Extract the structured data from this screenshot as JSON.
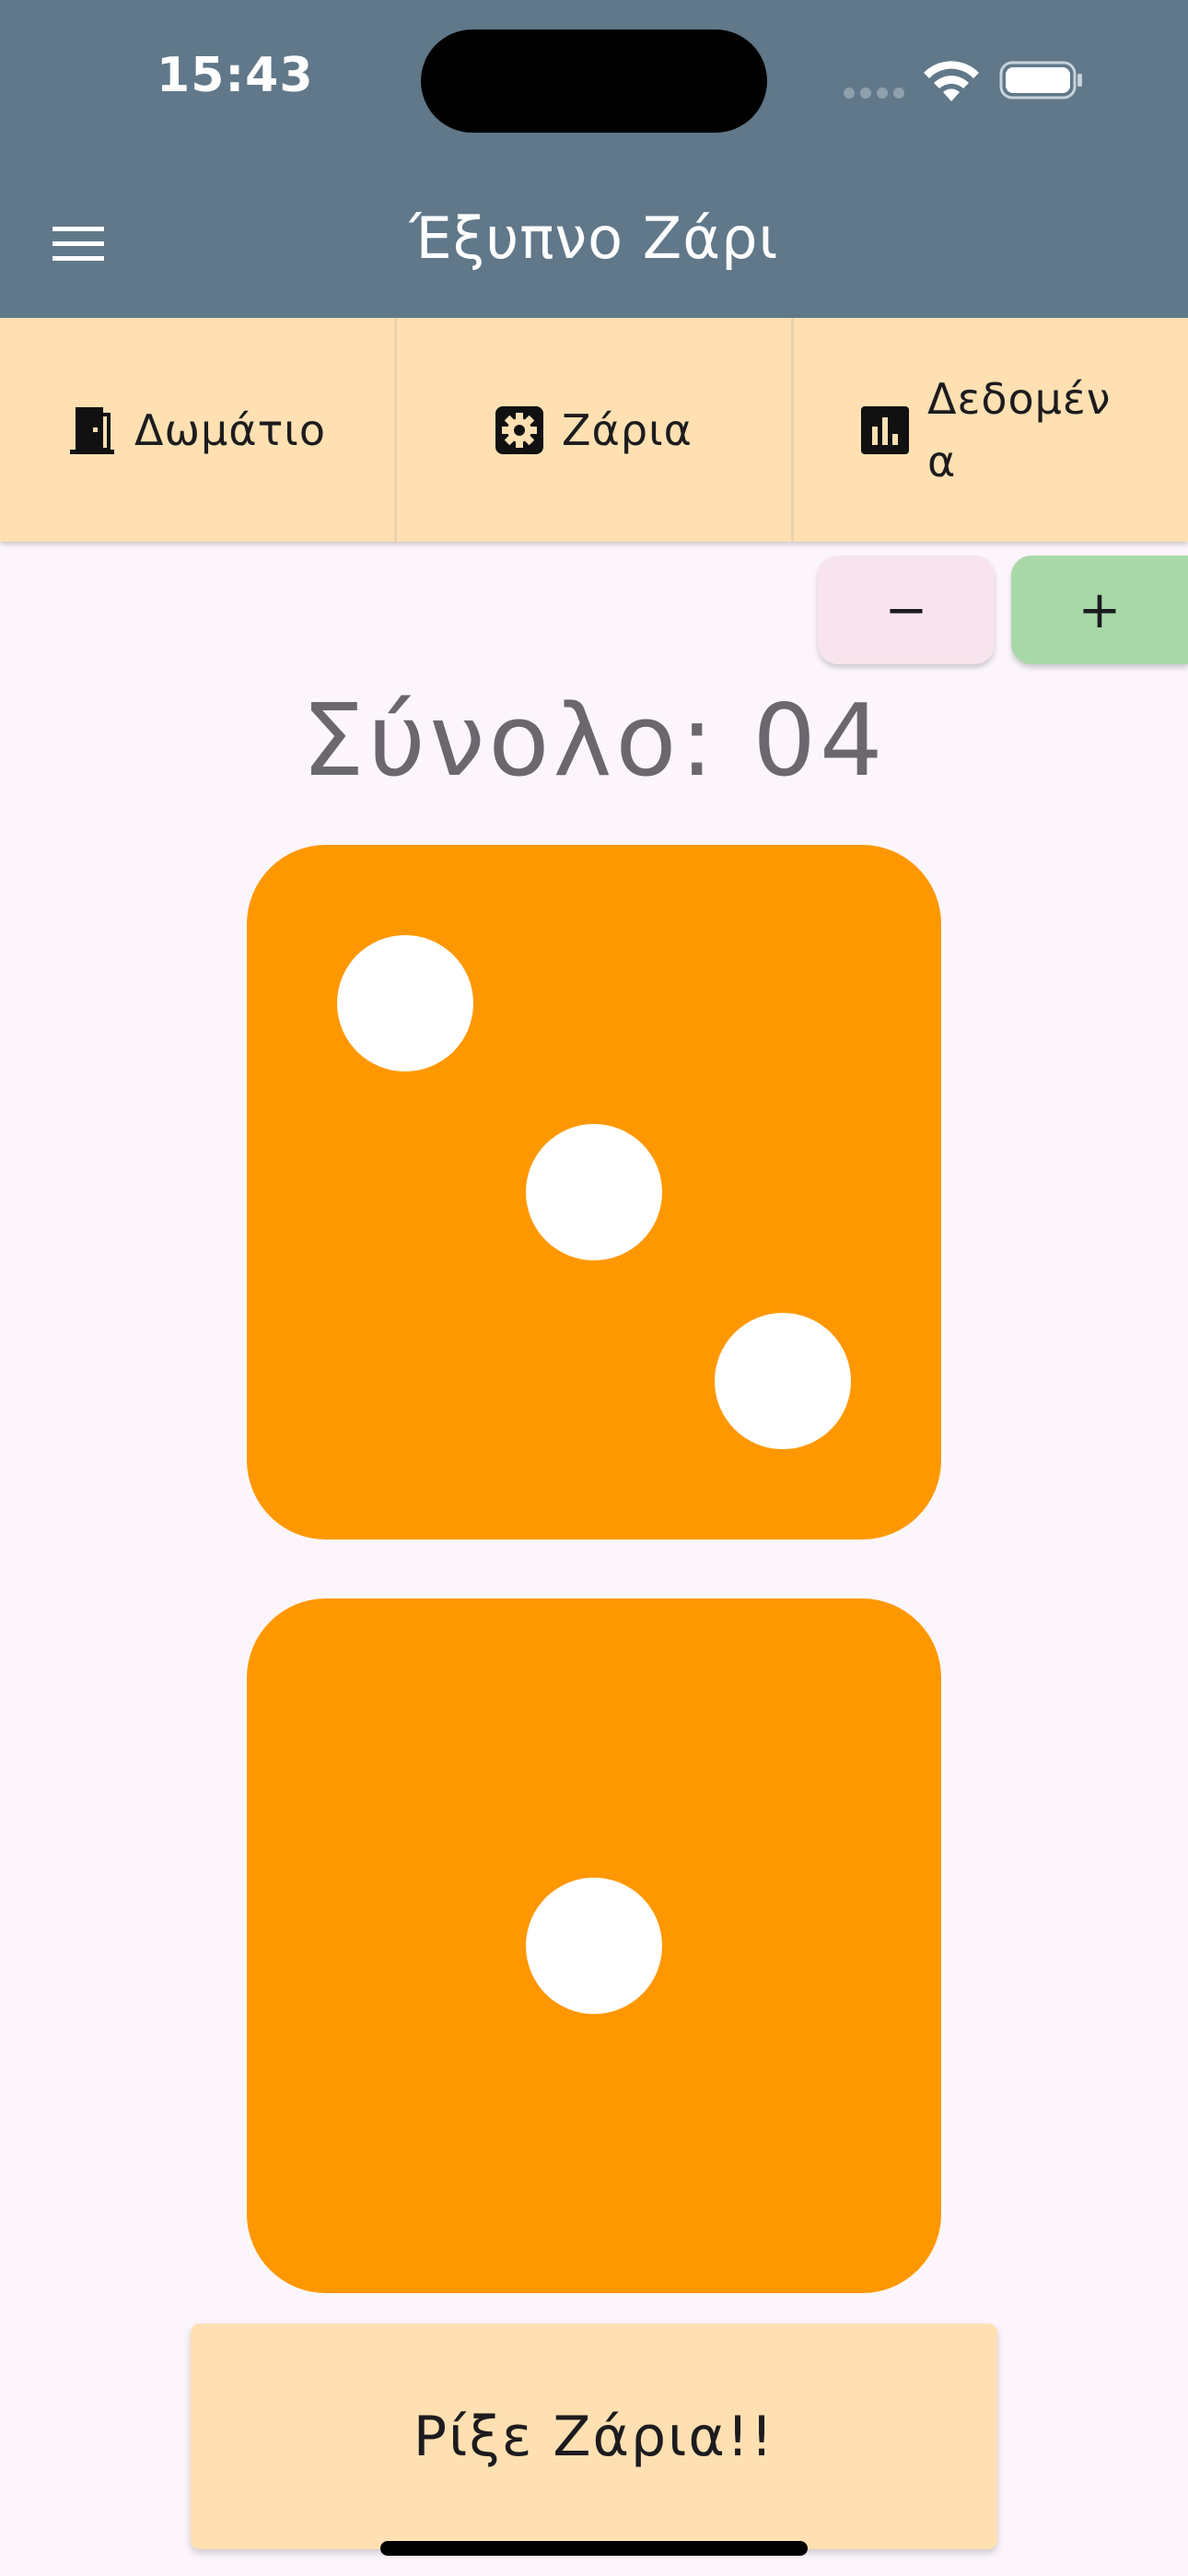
{
  "status_bar": {
    "time": "15:43"
  },
  "app_bar": {
    "title": "Έξυπνο Ζάρι",
    "menu_icon": "hamburger-menu-icon",
    "background": "#607889"
  },
  "tabs": [
    {
      "label": "Δωμάτιο",
      "icon": "door-icon"
    },
    {
      "label": "Ζάρια",
      "icon": "gear-icon"
    },
    {
      "label": "Δεδομένα",
      "icon": "bar-chart-icon"
    }
  ],
  "dice_controls": {
    "decrease_label": "−",
    "increase_label": "+"
  },
  "total": {
    "text": "Σύνολο: 04"
  },
  "dice": [
    {
      "value": 3
    },
    {
      "value": 1
    }
  ],
  "roll_button": {
    "label": "Ρίξε Ζάρια!!"
  },
  "colors": {
    "die": "#FF9800",
    "pip": "#FFFFFF",
    "tab_background": "#FFE0B2",
    "decrease_button": "#F8E4EC",
    "increase_button": "#A8D8A8"
  }
}
